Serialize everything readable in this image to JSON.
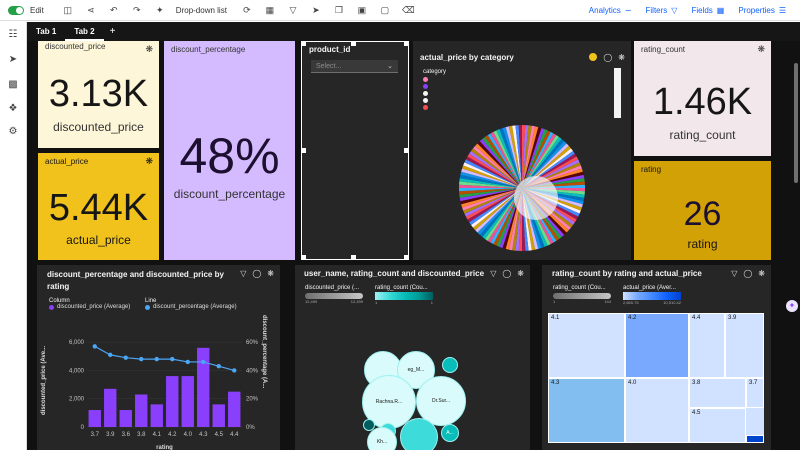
{
  "toolbar": {
    "edit_label": "Edit",
    "dropdown_label": "Drop-down list",
    "analytics_label": "Analytics",
    "filters_label": "Filters",
    "fields_label": "Fields",
    "properties_label": "Properties"
  },
  "tabs": [
    {
      "label": "Tab 1"
    },
    {
      "label": "Tab 2"
    }
  ],
  "tab_add": "+",
  "kpis": {
    "discounted_price": {
      "title": "discounted_price",
      "value": "3.13K",
      "label": "discounted_price"
    },
    "actual_price": {
      "title": "actual_price",
      "value": "5.44K",
      "label": "actual_price"
    },
    "discount_percentage": {
      "title": "discount_percentage",
      "value": "48%",
      "label": "discount_percentage"
    },
    "rating_count": {
      "title": "rating_count",
      "value": "1.46K",
      "label": "rating_count"
    },
    "rating": {
      "title": "rating",
      "value": "26",
      "label": "rating"
    }
  },
  "colors": {
    "discounted_price_bg": "#fdf6d8",
    "actual_price_bg": "#f1c21b",
    "discount_percentage_bg": "#d4bbff",
    "rating_count_bg": "#f2e8eb",
    "rating_bg": "#d2a106",
    "bar": "#8a3ffc",
    "line": "#4ba6f5"
  },
  "product_filter": {
    "title": "product_id",
    "placeholder": "Select..."
  },
  "pie_widget": {
    "title": "actual_price by category",
    "legend_title": "category"
  },
  "combo_widget": {
    "title": "discount_percentage and discounted_price by rating",
    "legend_column_title": "Column",
    "legend_column_item": "discounted_price (Average)",
    "legend_line_title": "Line",
    "legend_line_item": "discount_percentage (Average)",
    "ylabel_left": "discounted_price (Ave...",
    "ylabel_right": "discount_percentage (A...",
    "xlabel": "rating",
    "y_left_ticks": [
      "6,000",
      "4,000",
      "2,000",
      "0"
    ],
    "y_right_ticks": [
      "60%",
      "40%",
      "20%",
      "0%"
    ]
  },
  "chart_data": {
    "type": "bar",
    "categories": [
      "3.7",
      "3.9",
      "3.6",
      "3.8",
      "4.1",
      "4.2",
      "4.0",
      "4.3",
      "4.5",
      "4.4"
    ],
    "series": [
      {
        "name": "discounted_price (Average)",
        "type": "bar",
        "values": [
          1200,
          2700,
          1200,
          2300,
          1600,
          3600,
          3600,
          5600,
          1600,
          2500
        ]
      },
      {
        "name": "discount_percentage (Average)",
        "type": "line",
        "values": [
          57,
          51,
          49,
          48,
          48,
          48,
          46,
          46,
          43,
          40
        ]
      }
    ],
    "ylim": [
      0,
      7000
    ],
    "y2lim": [
      0,
      70
    ],
    "xlabel": "rating",
    "ylabel": "discounted_price (Ave...",
    "y2label": "discount_percentage (A..."
  },
  "bubble_widget": {
    "title": "user_name, rating_count and discounted_price",
    "legend1_title": "discounted_price (...",
    "legend1_min": "12,499",
    "legend1_max": "12,499",
    "legend2_title": "rating_count (Cou...",
    "legend2_min": "1",
    "legend2_max": "1",
    "bubbles": [
      {
        "label": "",
        "color": "#d9fbfb"
      },
      {
        "label": "eg_M...",
        "color": "#d9fbfb"
      },
      {
        "label": "",
        "color": "#08bdba"
      },
      {
        "label": "Rachna.R...",
        "color": "#d9fbfb"
      },
      {
        "label": "Dr.Sur...",
        "color": "#d9fbfb"
      },
      {
        "label": "",
        "color": "#005d5d"
      },
      {
        "label": "",
        "color": "#3ddbd9"
      },
      {
        "label": "Kh...",
        "color": "#d9fbfb"
      },
      {
        "label": "",
        "color": "#3ddbd9"
      },
      {
        "label": "A...",
        "color": "#08bdba"
      }
    ]
  },
  "treemap_widget": {
    "title": "rating_count by rating and actual_price",
    "legend1_title": "rating_count (Cou...",
    "legend1_min": "1",
    "legend1_max": "144",
    "legend2_title": "actual_price (Aver...",
    "legend2_min": "2,665.75",
    "legend2_max": "10,510.42",
    "cells": [
      {
        "label": "4.1",
        "color": "#d0e2ff"
      },
      {
        "label": "4.2",
        "color": "#78a9ff"
      },
      {
        "label": "4.4",
        "color": "#d0e2ff"
      },
      {
        "label": "3.9",
        "color": "#d0e2ff"
      },
      {
        "label": "4.3",
        "color": "#82bff0"
      },
      {
        "label": "4.0",
        "color": "#d0e2ff"
      },
      {
        "label": "3.8",
        "color": "#d0e2ff"
      },
      {
        "label": "3.7",
        "color": "#d0e2ff"
      },
      {
        "label": "4.5",
        "color": "#d0e2ff"
      }
    ]
  }
}
